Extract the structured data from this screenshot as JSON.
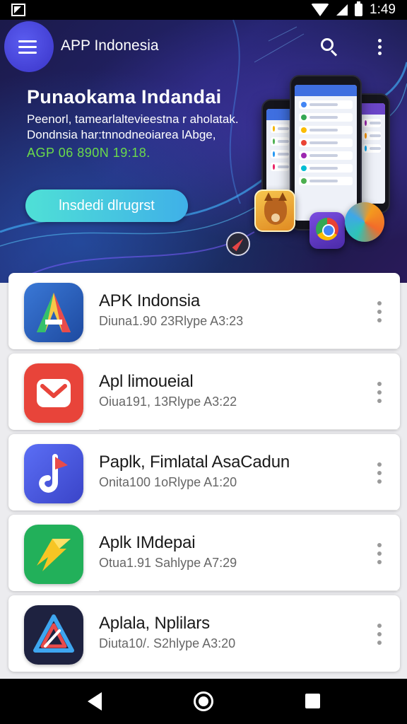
{
  "status_bar": {
    "time": "1:49",
    "icons": [
      "notification-icon",
      "wifi-icon",
      "signal-icon",
      "battery-icon"
    ]
  },
  "app_bar": {
    "title": "APP Indonesia",
    "icons": [
      "menu-icon",
      "search-icon",
      "more-vert-icon"
    ]
  },
  "hero": {
    "title": "Punaokama Indandai",
    "description": "Peenorl, tamearlaltevieestna r aholatak. Dondnsia har:tnnodneoiarea lAbge,",
    "date": "AGP 06 890N 19:18.",
    "cta_label": "lnsdedi dlrugrst"
  },
  "apps": [
    {
      "name": "APK Indonsia",
      "meta": "Diuna1.90 23Rlype A3:23",
      "icon": "apk-indonsia-a-icon",
      "color": "#2e5fb5"
    },
    {
      "name": "Apl limoueial",
      "meta": "Oiua191, 13Rlype A3:22",
      "icon": "mail-icon",
      "color": "#e8443a"
    },
    {
      "name": "Paplk, Fimlatal  AsaCadun",
      "meta": "Onita100 1oRlype A1:20",
      "icon": "music-note-icon",
      "color": "#4a5fe0"
    },
    {
      "name": "Aplk IMdepai",
      "meta": "Otua1.91 Sahlype A7:29",
      "icon": "lightning-icon",
      "color": "#22b05a"
    },
    {
      "name": "Aplala, Nplilars",
      "meta": "Diuta10/. S2hlype A3:20",
      "icon": "triangle-logo-icon",
      "color": "#1e2240"
    }
  ],
  "colors": {
    "accent": "#4b4fe6",
    "cta_start": "#4fe0d6",
    "cta_end": "#3fb0e8",
    "hero_date": "#6bdc4a"
  }
}
